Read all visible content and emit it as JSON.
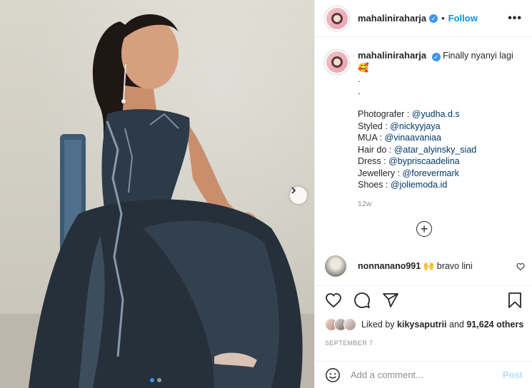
{
  "post": {
    "username": "mahaliniraharja",
    "verified_glyph": "✓",
    "separator": "•",
    "follow_label": "Follow",
    "more_label": "•••"
  },
  "caption": {
    "username": "mahaliniraharja",
    "text": "Finally nyanyi lagi🥰",
    "dot1": ".",
    "dot2": ".",
    "credits": [
      {
        "label": "Photografer : ",
        "mention": "@yudha.d.s"
      },
      {
        "label": "Styled : ",
        "mention": "@nickyyjaya"
      },
      {
        "label": "MUA : ",
        "mention": "@vinaavaniaa"
      },
      {
        "label": "Hair do : ",
        "mention": "@atar_alyinsky_siad"
      },
      {
        "label": "Dress : ",
        "mention": "@bypriscaadelina"
      },
      {
        "label": "Jewellery : ",
        "mention": "@forevermark"
      },
      {
        "label": "Shoes : ",
        "mention": "@joliemoda.id"
      }
    ],
    "time_ago": "12w"
  },
  "load_more": {
    "label": "+"
  },
  "comment": {
    "username": "nonnanano991",
    "text": "🙌 bravo lini"
  },
  "likes": {
    "prefix": "Liked by",
    "user": "kikysaputrii",
    "middle": "and",
    "count": "91,624 others"
  },
  "date": "SEPTEMBER 7",
  "add_comment": {
    "placeholder": "Add a comment...",
    "post_label": "Post"
  },
  "carousel": {
    "total": 2,
    "current": 1
  },
  "icons": {
    "heart": "heart-icon",
    "comment": "comment-icon",
    "share": "share-icon",
    "save": "bookmark-icon",
    "emoji": "emoji-icon",
    "next": "chevron-right-icon"
  },
  "colors": {
    "accent": "#0095f6",
    "mention": "#00376b",
    "muted": "#8e8e8e",
    "post_disabled": "#b2dffc"
  }
}
